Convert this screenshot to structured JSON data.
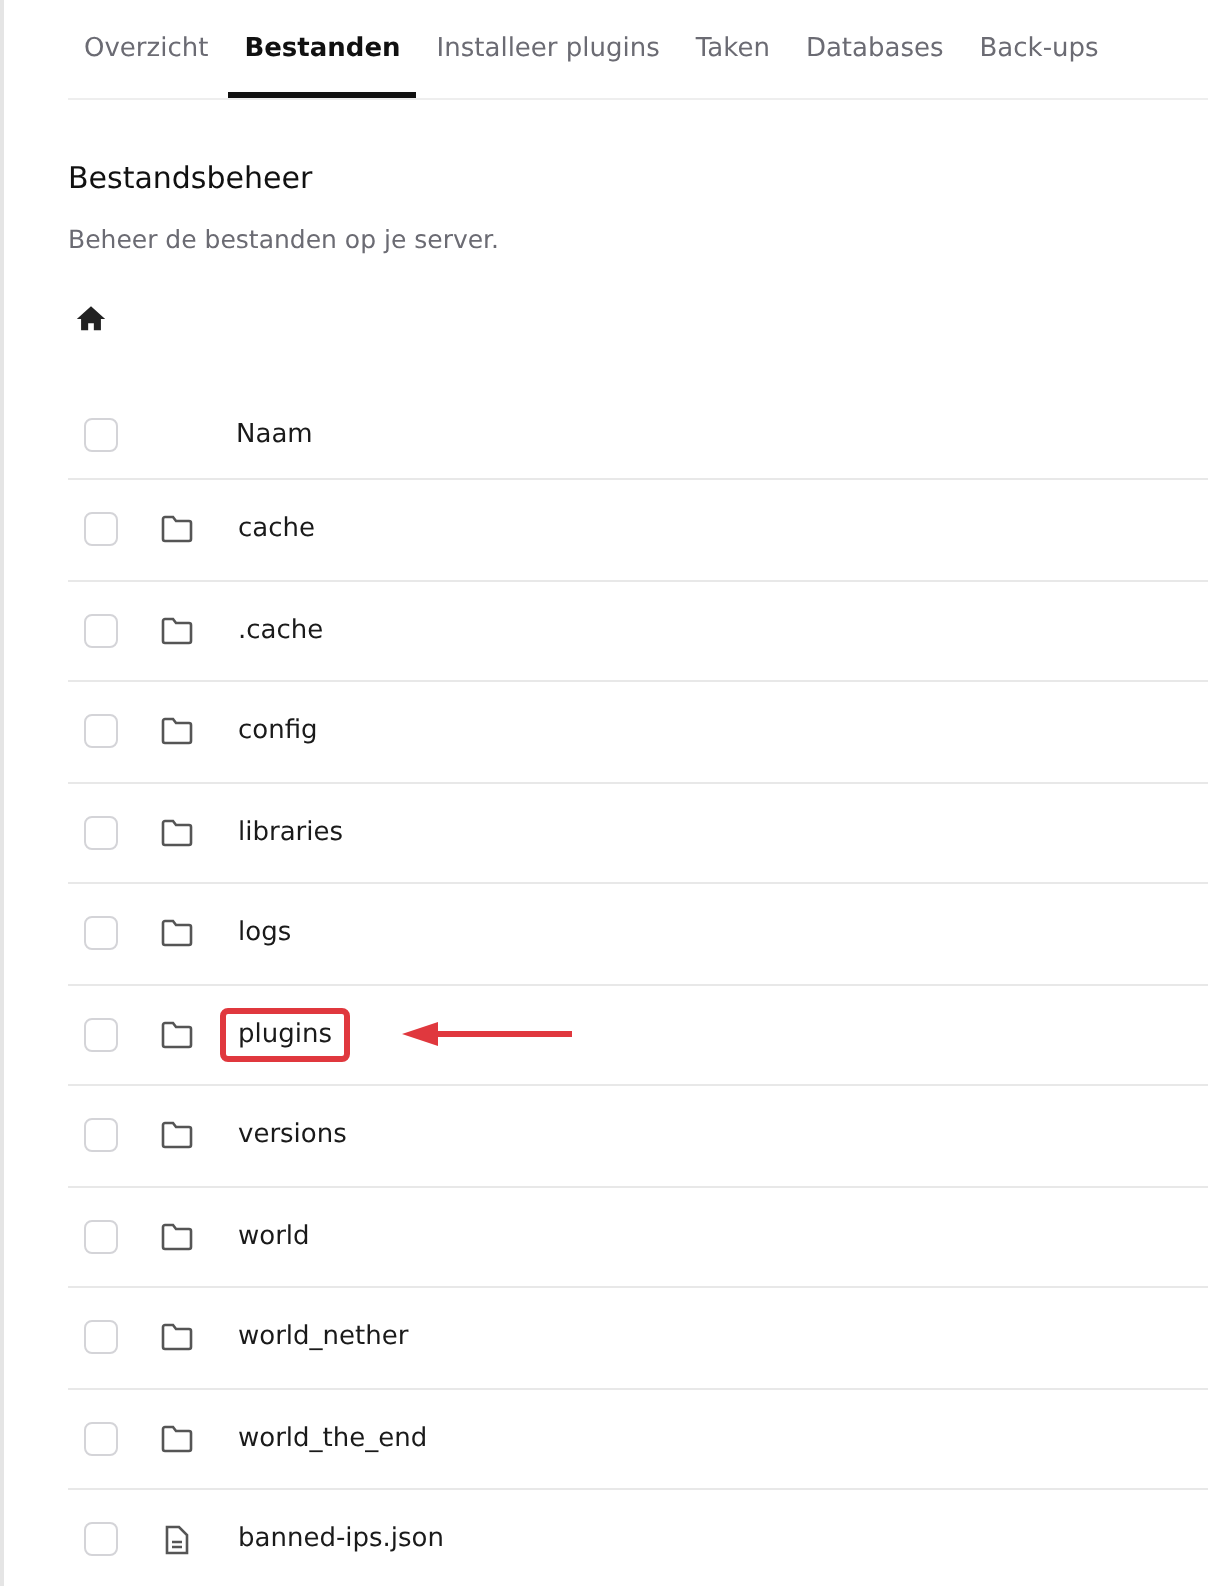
{
  "tabs": [
    {
      "label": "Overzicht",
      "selected": false
    },
    {
      "label": "Bestanden",
      "selected": true
    },
    {
      "label": "Installeer plugins",
      "selected": false
    },
    {
      "label": "Taken",
      "selected": false
    },
    {
      "label": "Databases",
      "selected": false
    },
    {
      "label": "Back-ups",
      "selected": false
    }
  ],
  "title": "Bestandsbeheer",
  "subtitle": "Beheer de bestanden op je server.",
  "table": {
    "header": {
      "label": "Naam",
      "checked": false
    },
    "rows": [
      {
        "kind": "folder",
        "name": "cache",
        "checked": false,
        "highlighted": false
      },
      {
        "kind": "folder",
        "name": ".cache",
        "checked": false,
        "highlighted": false
      },
      {
        "kind": "folder",
        "name": "config",
        "checked": false,
        "highlighted": false
      },
      {
        "kind": "folder",
        "name": "libraries",
        "checked": false,
        "highlighted": false
      },
      {
        "kind": "folder",
        "name": "logs",
        "checked": false,
        "highlighted": false
      },
      {
        "kind": "folder",
        "name": "plugins",
        "checked": false,
        "highlighted": true
      },
      {
        "kind": "folder",
        "name": "versions",
        "checked": false,
        "highlighted": false
      },
      {
        "kind": "folder",
        "name": "world",
        "checked": false,
        "highlighted": false
      },
      {
        "kind": "folder",
        "name": "world_nether",
        "checked": false,
        "highlighted": false
      },
      {
        "kind": "folder",
        "name": "world_the_end",
        "checked": false,
        "highlighted": false
      },
      {
        "kind": "file",
        "name": "banned-ips.json",
        "checked": false,
        "highlighted": false
      }
    ]
  }
}
